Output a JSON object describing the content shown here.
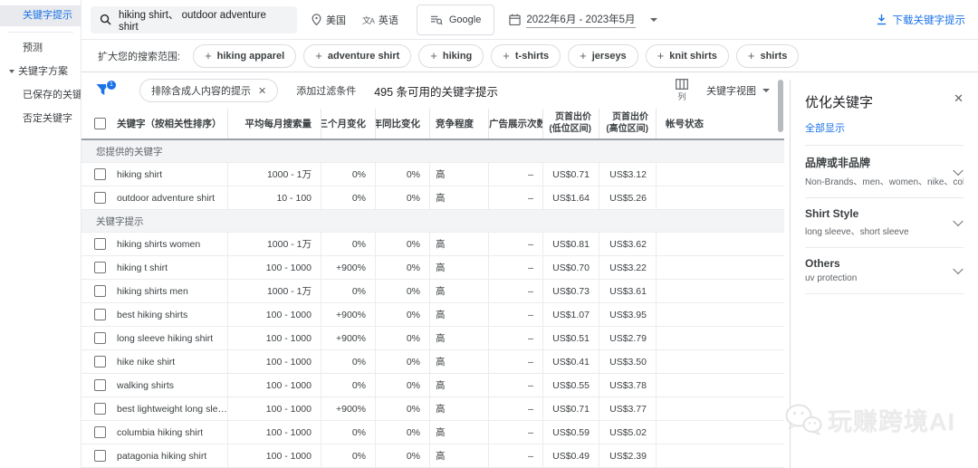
{
  "sidebar": {
    "items": [
      {
        "label": "关键字提示",
        "selected": true
      },
      {
        "label": "预测",
        "selected": false
      },
      {
        "label": "关键字方案",
        "selected": false,
        "expandable": true
      },
      {
        "label": "已保存的关键字",
        "selected": false
      },
      {
        "label": "否定关键字",
        "selected": false
      }
    ]
  },
  "toolbar": {
    "search_value": "hiking shirt、 outdoor adventure shirt",
    "location": "美国",
    "language": "英语",
    "network": "Google",
    "date_range": "2022年6月 - 2023年5月",
    "download_label": "下载关键字提示"
  },
  "expand_row": {
    "label": "扩大您的搜索范围:",
    "chips": [
      "hiking apparel",
      "adventure shirt",
      "hiking",
      "t-shirts",
      "jerseys",
      "knit shirts",
      "shirts"
    ]
  },
  "filter_bar": {
    "filter_count": "1",
    "active_filter": "排除含成人内容的提示",
    "add_filter_label": "添加过滤条件",
    "results_text": "495 条可用的关键字提示",
    "columns_label": "列",
    "view_label": "关键字视图"
  },
  "table": {
    "headers": [
      {
        "line1": "关键字（按相关性排序）"
      },
      {
        "line1": "平均每月搜索量"
      },
      {
        "line1": "三个月变化"
      },
      {
        "line1": "年同比变化"
      },
      {
        "line1": "竞争程度"
      },
      {
        "line1": "广告展示次数份额"
      },
      {
        "line1": "页首出价",
        "line2": "(低位区间)"
      },
      {
        "line1": "页首出价",
        "line2": "(高位区间)"
      },
      {
        "line1": "帐号状态"
      }
    ],
    "sections": [
      {
        "title": "您提供的关键字",
        "rows": [
          {
            "keyword": "hiking shirt",
            "volume": "1000 - 1万",
            "three_month": "0%",
            "yoy": "0%",
            "competition": "高",
            "ad_share": "–",
            "low_bid": "US$0.71",
            "high_bid": "US$3.12",
            "status": ""
          },
          {
            "keyword": "outdoor adventure shirt",
            "volume": "10 - 100",
            "three_month": "0%",
            "yoy": "0%",
            "competition": "高",
            "ad_share": "–",
            "low_bid": "US$1.64",
            "high_bid": "US$5.26",
            "status": ""
          }
        ]
      },
      {
        "title": "关键字提示",
        "rows": [
          {
            "keyword": "hiking shirts women",
            "volume": "1000 - 1万",
            "three_month": "0%",
            "yoy": "0%",
            "competition": "高",
            "ad_share": "–",
            "low_bid": "US$0.81",
            "high_bid": "US$3.62",
            "status": ""
          },
          {
            "keyword": "hiking t shirt",
            "volume": "100 - 1000",
            "three_month": "+900%",
            "yoy": "0%",
            "competition": "高",
            "ad_share": "–",
            "low_bid": "US$0.70",
            "high_bid": "US$3.22",
            "status": ""
          },
          {
            "keyword": "hiking shirts men",
            "volume": "1000 - 1万",
            "three_month": "0%",
            "yoy": "0%",
            "competition": "高",
            "ad_share": "–",
            "low_bid": "US$0.73",
            "high_bid": "US$3.61",
            "status": ""
          },
          {
            "keyword": "best hiking shirts",
            "volume": "100 - 1000",
            "three_month": "+900%",
            "yoy": "0%",
            "competition": "高",
            "ad_share": "–",
            "low_bid": "US$1.07",
            "high_bid": "US$3.95",
            "status": ""
          },
          {
            "keyword": "long sleeve hiking shirt",
            "volume": "100 - 1000",
            "three_month": "+900%",
            "yoy": "0%",
            "competition": "高",
            "ad_share": "–",
            "low_bid": "US$0.51",
            "high_bid": "US$2.79",
            "status": ""
          },
          {
            "keyword": "hike nike shirt",
            "volume": "100 - 1000",
            "three_month": "0%",
            "yoy": "0%",
            "competition": "高",
            "ad_share": "–",
            "low_bid": "US$0.41",
            "high_bid": "US$3.50",
            "status": ""
          },
          {
            "keyword": "walking shirts",
            "volume": "100 - 1000",
            "three_month": "0%",
            "yoy": "0%",
            "competition": "高",
            "ad_share": "–",
            "low_bid": "US$0.55",
            "high_bid": "US$3.78",
            "status": ""
          },
          {
            "keyword": "best lightweight long sleeve hiking…",
            "volume": "100 - 1000",
            "three_month": "+900%",
            "yoy": "0%",
            "competition": "高",
            "ad_share": "–",
            "low_bid": "US$0.71",
            "high_bid": "US$3.77",
            "status": ""
          },
          {
            "keyword": "columbia hiking shirt",
            "volume": "100 - 1000",
            "three_month": "0%",
            "yoy": "0%",
            "competition": "高",
            "ad_share": "–",
            "low_bid": "US$0.59",
            "high_bid": "US$5.02",
            "status": ""
          },
          {
            "keyword": "patagonia hiking shirt",
            "volume": "100 - 1000",
            "three_month": "0%",
            "yoy": "0%",
            "competition": "高",
            "ad_share": "–",
            "low_bid": "US$0.49",
            "high_bid": "US$2.39",
            "status": ""
          }
        ]
      }
    ]
  },
  "refine_panel": {
    "title": "优化关键字",
    "show_all_label": "全部显示",
    "close_icon": "✕",
    "groups": [
      {
        "name": "品牌或非品牌",
        "options": "Non-Brands、men、women、nike、columbia"
      },
      {
        "name": "Shirt Style",
        "options": "long sleeve、short sleeve"
      },
      {
        "name": "Others",
        "options": "uv protection"
      }
    ]
  },
  "watermark": {
    "text": "玩赚跨境AI"
  },
  "colors": {
    "accent": "#1a73e8",
    "selected_bg": "#e8eaed",
    "border": "#dadce0",
    "text_primary": "#3c4043",
    "text_secondary": "#5f6368"
  }
}
